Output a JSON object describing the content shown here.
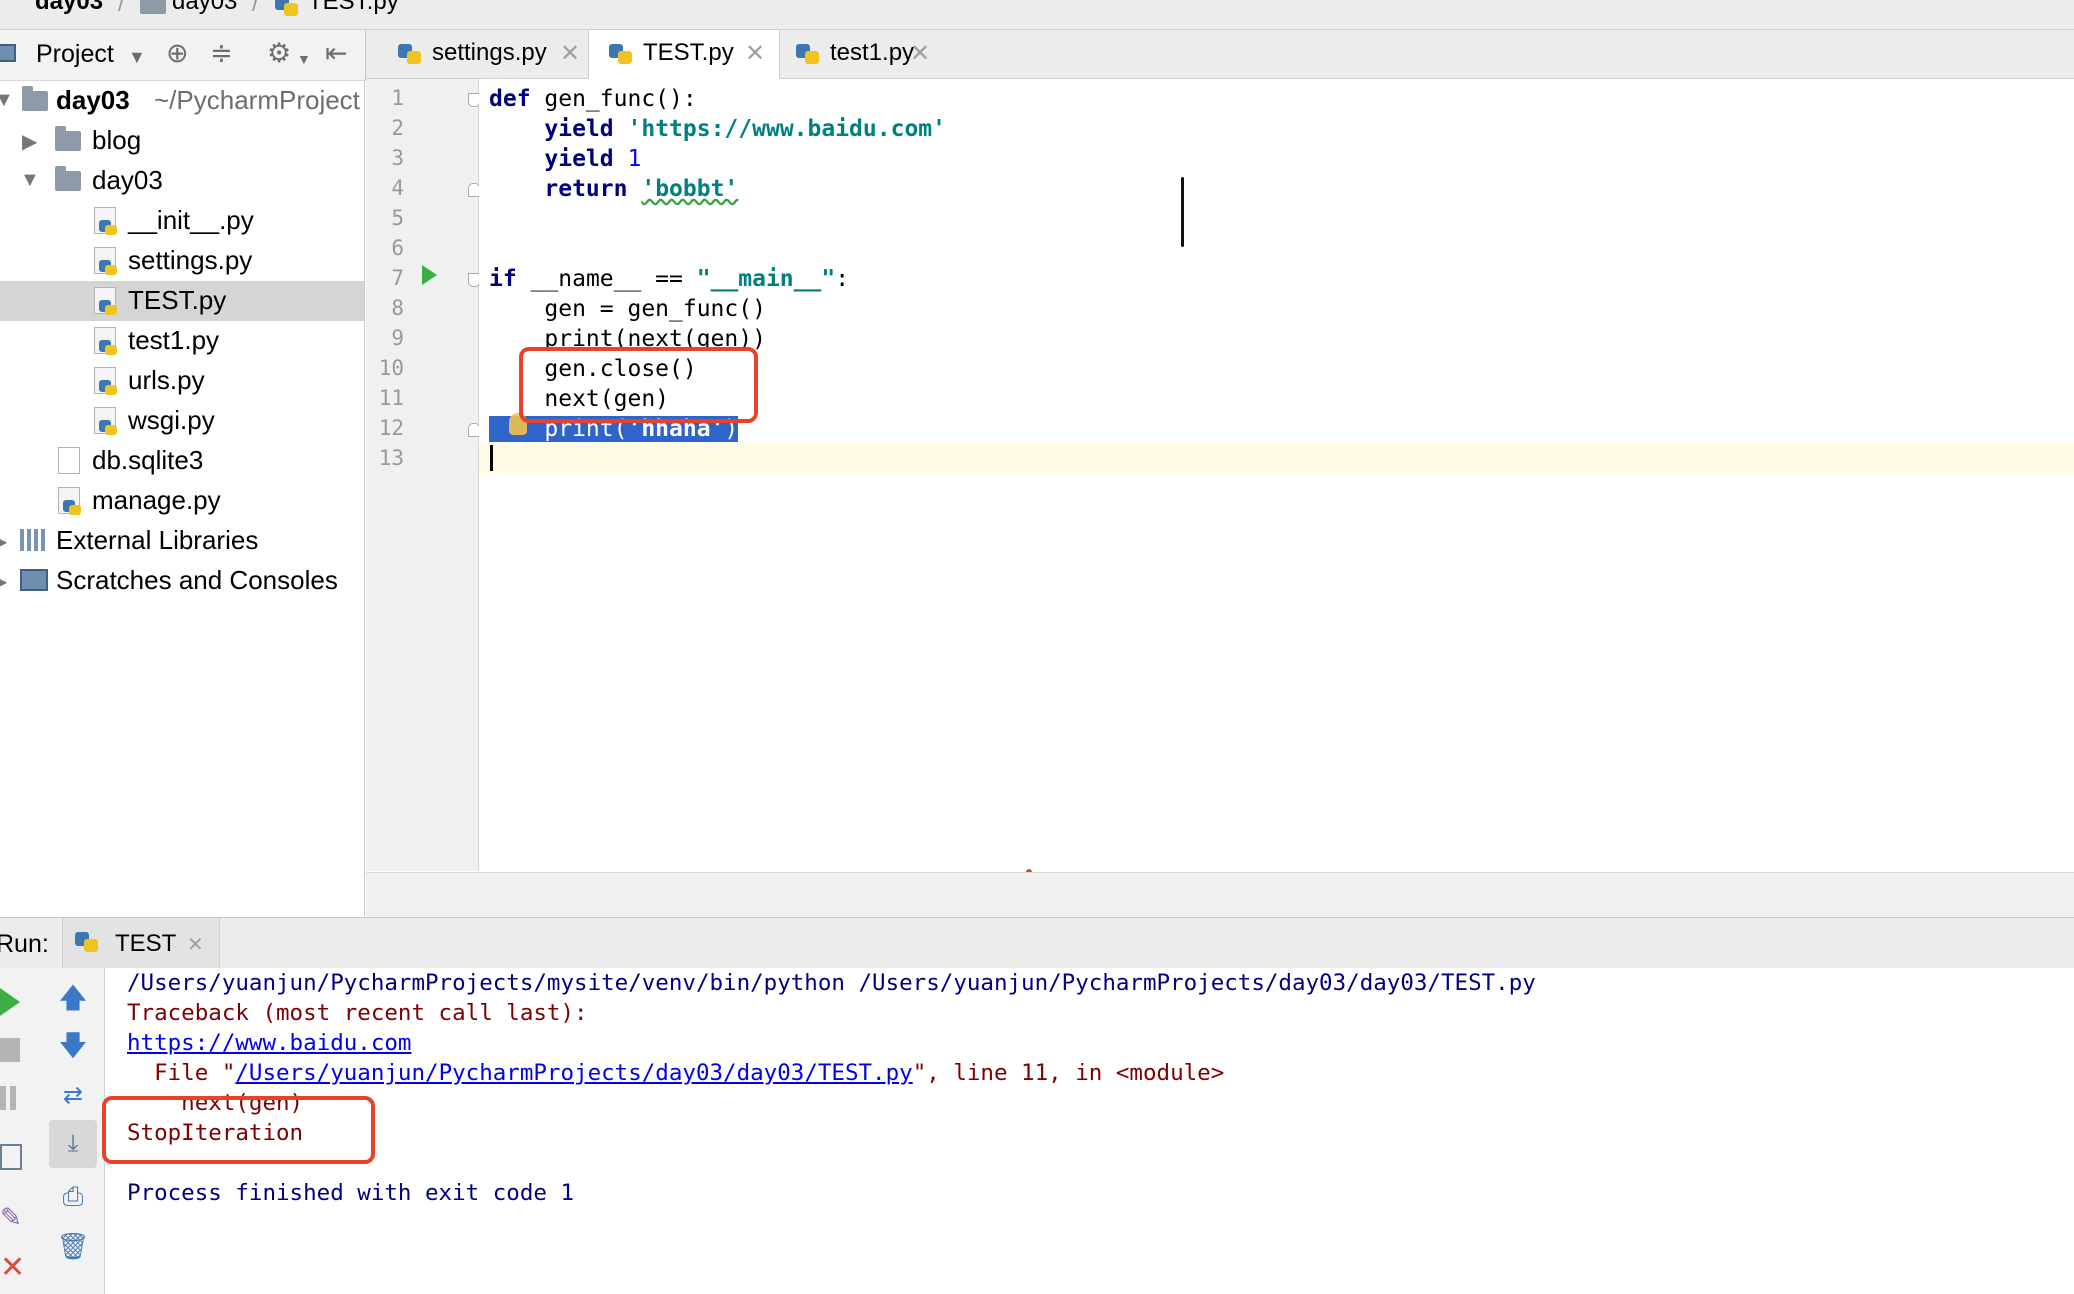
{
  "breadcrumb": {
    "items": [
      "day03",
      "day03",
      "TEST.py"
    ]
  },
  "project_toolbar": {
    "title": "Project"
  },
  "project_tree": {
    "root_label": "day03",
    "root_path": "~/PycharmProject",
    "items": [
      {
        "label": "blog"
      },
      {
        "label": "day03"
      },
      {
        "label": "__init__.py"
      },
      {
        "label": "settings.py"
      },
      {
        "label": "TEST.py"
      },
      {
        "label": "test1.py"
      },
      {
        "label": "urls.py"
      },
      {
        "label": "wsgi.py"
      },
      {
        "label": "db.sqlite3"
      },
      {
        "label": "manage.py"
      },
      {
        "label": "External Libraries"
      },
      {
        "label": "Scratches and Consoles"
      }
    ]
  },
  "editor_tabs": [
    {
      "label": "settings.py"
    },
    {
      "label": "TEST.py"
    },
    {
      "label": "test1.py"
    }
  ],
  "editor": {
    "line_numbers": [
      "1",
      "2",
      "3",
      "4",
      "5",
      "6",
      "7",
      "8",
      "9",
      "10",
      "11",
      "12",
      "13"
    ],
    "lines": {
      "l1_kw": "def",
      "l1_rest": " gen_func():",
      "l2_kw": "yield",
      "l2_str": "'https://www.baidu.com'",
      "l3_kw": "yield",
      "l3_num": "1",
      "l4_kw": "return",
      "l4_str": "'bobbt'",
      "l7_kw": "if",
      "l7_mid": " __name__ == ",
      "l7_str": "\"__main__\"",
      "l7_end": ":",
      "l8": "gen = gen_func()",
      "l9": "print(next(gen))",
      "l10": "gen.close()",
      "l11": "next(gen)",
      "l12_a": "print(",
      "l12_str": "'hhaha'",
      "l12_b": ")"
    }
  },
  "run_panel": {
    "label": "Run:",
    "tab_label": "TEST",
    "console": {
      "cmd": "/Users/yuanjun/PycharmProjects/mysite/venv/bin/python /Users/yuanjun/PycharmProjects/day03/day03/TEST.py",
      "traceback": "Traceback (most recent call last):",
      "output_link": "https://www.baidu.com",
      "file_prefix": "  File \"",
      "file_link": "/Users/yuanjun/PycharmProjects/day03/day03/TEST.py",
      "file_suffix": "\", line 11, in <module>",
      "source_line": "    next(gen)",
      "error": "StopIteration",
      "exit": "Process finished with exit code 1"
    }
  },
  "colors": {
    "annotation_red": "#e8432a",
    "selection_blue": "#2f65ca",
    "keyword_navy": "#000080",
    "string_teal": "#008080"
  }
}
